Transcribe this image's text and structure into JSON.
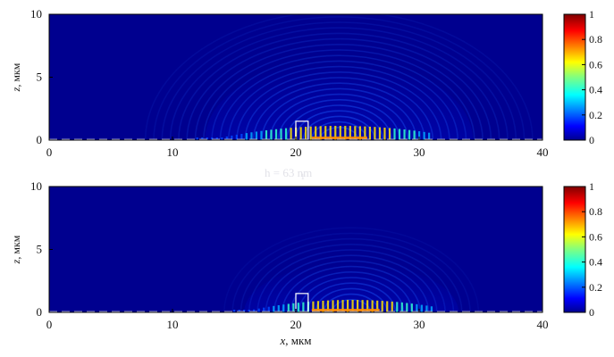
{
  "chart_data": [
    {
      "type": "heatmap",
      "xlim": [
        0,
        40
      ],
      "ylim": [
        0,
        10
      ],
      "x_ticks": [
        "0",
        "10",
        "20",
        "30",
        "40"
      ],
      "y_ticks": [
        "0",
        "5",
        "10"
      ],
      "xlabel": "",
      "ylabel_var": "z",
      "ylabel_unit": ", мкм",
      "colorbar": {
        "min": 0,
        "max": 1,
        "ticks": [
          "0",
          "0.2",
          "0.4",
          "0.6",
          "0.8",
          "1"
        ],
        "colormap": "jet"
      },
      "dashed_line_z": 0.05,
      "rect_x": [
        20,
        21
      ],
      "rect_z": [
        0,
        1.5
      ],
      "field_center_x": 23.5,
      "field_extent_x": [
        12,
        31
      ],
      "annotation": "h  = 63 nm",
      "annotation_sub": "1"
    },
    {
      "type": "heatmap",
      "xlim": [
        0,
        40
      ],
      "ylim": [
        0,
        10
      ],
      "x_ticks": [
        "0",
        "10",
        "20",
        "30",
        "40"
      ],
      "y_ticks": [
        "0",
        "5",
        "10"
      ],
      "xlabel_var": "x",
      "xlabel_unit": ", мкм",
      "ylabel_var": "z",
      "ylabel_unit": ", мкм",
      "colorbar": {
        "min": 0,
        "max": 1,
        "ticks": [
          "0",
          "0.2",
          "0.4",
          "0.6",
          "0.8",
          "1"
        ],
        "colormap": "jet"
      },
      "dashed_line_z": 0.05,
      "rect_x": [
        20,
        21
      ],
      "rect_z": [
        0,
        1.5
      ],
      "field_center_x": 24.5,
      "field_extent_x": [
        15,
        31
      ]
    }
  ],
  "colors": {
    "background": "#00008f",
    "frame": "#000000",
    "dash": "#c8c8e8",
    "rect": "#ffffff"
  }
}
